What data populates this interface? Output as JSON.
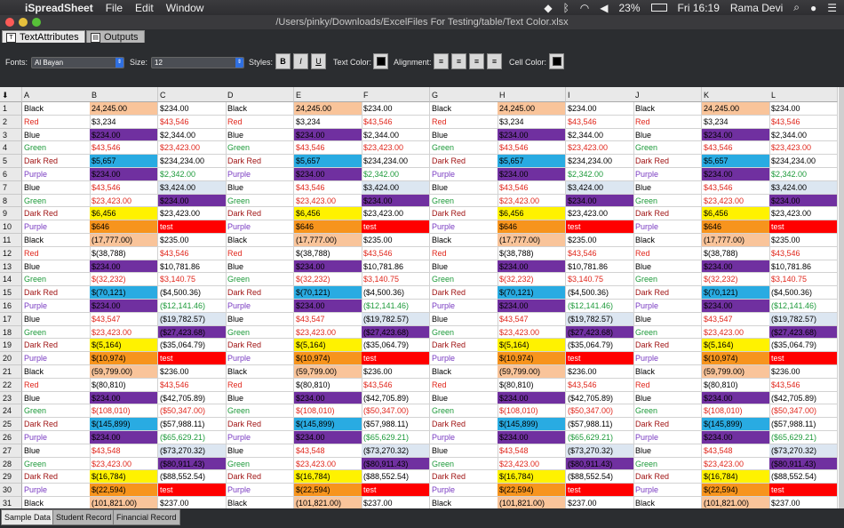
{
  "menubar": {
    "app": "iSpreadSheet",
    "items": [
      "File",
      "Edit",
      "Window"
    ],
    "battery": "23%",
    "clock": "Fri 16:19",
    "user": "Rama Devi"
  },
  "window": {
    "title": "/Users/pinky/Downloads/ExcelFiles For Testing/table/Text Color.xlsx"
  },
  "top_tabs": [
    {
      "label": "TextAttributes",
      "active": true
    },
    {
      "label": "Outputs",
      "active": false
    }
  ],
  "toolbar": {
    "fonts_label": "Fonts:",
    "font_value": "Al Bayan",
    "size_label": "Size:",
    "size_value": "12",
    "styles_label": "Styles:",
    "style_buttons": [
      "B",
      "I",
      "U"
    ],
    "text_color_label": "Text Color:",
    "alignment_label": "Alignment:",
    "cell_color_label": "Cell Color:"
  },
  "columns": [
    "A",
    "B",
    "C",
    "D",
    "E",
    "F",
    "G",
    "H",
    "I",
    "J",
    "K",
    "L"
  ],
  "rows": [
    {
      "n": "1",
      "a": "Black",
      "b": "24,245.00",
      "c": "$234.00"
    },
    {
      "n": "2",
      "a": "Red",
      "b": "$3,234",
      "c": "$43,546"
    },
    {
      "n": "3",
      "a": "Blue",
      "b": "$234.00",
      "c": "$2,344.00"
    },
    {
      "n": "4",
      "a": "Green",
      "b": "$43,546",
      "c": "$23,423.00"
    },
    {
      "n": "5",
      "a": "Dark Red",
      "b": "$5,657",
      "c": "$234,234.00"
    },
    {
      "n": "6",
      "a": "Purple",
      "b": "$234.00",
      "c": "$2,342.00"
    },
    {
      "n": "7",
      "a": "Blue",
      "b": "$43,546",
      "c": "$3,424.00"
    },
    {
      "n": "8",
      "a": "Green",
      "b": "$23,423.00",
      "c": "$234.00"
    },
    {
      "n": "9",
      "a": "Dark Red",
      "b": "$6,456",
      "c": "$23,423.00"
    },
    {
      "n": "10",
      "a": "Purple",
      "b": "$646",
      "c": "test"
    },
    {
      "n": "11",
      "a": "Black",
      "b": "(17,777.00)",
      "c": "$235.00"
    },
    {
      "n": "12",
      "a": "Red",
      "b": "$(38,788)",
      "c": "$43,546"
    },
    {
      "n": "13",
      "a": "Blue",
      "b": "$234.00",
      "c": "$10,781.86"
    },
    {
      "n": "14",
      "a": "Green",
      "b": "$(32,232)",
      "c": "$3,140.75"
    },
    {
      "n": "15",
      "a": "Dark Red",
      "b": "$(70,121)",
      "c": "($4,500.36)"
    },
    {
      "n": "16",
      "a": "Purple",
      "b": "$234.00",
      "c": "($12,141.46)"
    },
    {
      "n": "17",
      "a": "Blue",
      "b": "$43,547",
      "c": "($19,782.57)"
    },
    {
      "n": "18",
      "a": "Green",
      "b": "$23,423.00",
      "c": "($27,423.68)"
    },
    {
      "n": "19",
      "a": "Dark Red",
      "b": "$(5,164)",
      "c": "($35,064.79)"
    },
    {
      "n": "20",
      "a": "Purple",
      "b": "$(10,974)",
      "c": "test"
    },
    {
      "n": "21",
      "a": "Black",
      "b": "(59,799.00)",
      "c": "$236.00"
    },
    {
      "n": "22",
      "a": "Red",
      "b": "$(80,810)",
      "c": "$43,546"
    },
    {
      "n": "23",
      "a": "Blue",
      "b": "$234.00",
      "c": "($42,705.89)"
    },
    {
      "n": "24",
      "a": "Green",
      "b": "$(108,010)",
      "c": "($50,347.00)"
    },
    {
      "n": "25",
      "a": "Dark Red",
      "b": "$(145,899)",
      "c": "($57,988.11)"
    },
    {
      "n": "26",
      "a": "Purple",
      "b": "$234.00",
      "c": "($65,629.21)"
    },
    {
      "n": "27",
      "a": "Blue",
      "b": "$43,548",
      "c": "($73,270.32)"
    },
    {
      "n": "28",
      "a": "Green",
      "b": "$23,423.00",
      "c": "($80,911.43)"
    },
    {
      "n": "29",
      "a": "Dark Red",
      "b": "$(16,784)",
      "c": "($88,552.54)"
    },
    {
      "n": "30",
      "a": "Purple",
      "b": "$(22,594)",
      "c": "test"
    },
    {
      "n": "31",
      "a": "Black",
      "b": "(101,821.00)",
      "c": "$237.00"
    }
  ],
  "bottom_tabs": [
    {
      "label": "Sample Data",
      "active": true
    },
    {
      "label": "Student Record",
      "active": false
    },
    {
      "label": "Financial Record",
      "active": false
    }
  ],
  "colors": {
    "black": "#000000",
    "red": "#e0271c",
    "blue": "#000000",
    "green": "#1d9a3a",
    "darkred": "#a01414",
    "purple": "#7a3cc2",
    "peach": "#f9c49a",
    "violet": "#7030a0",
    "sky": "#29abe2",
    "yellow": "#fff200",
    "orange": "#f7941d",
    "redfill": "#ff0000",
    "lightblue": "#dce6f1"
  }
}
